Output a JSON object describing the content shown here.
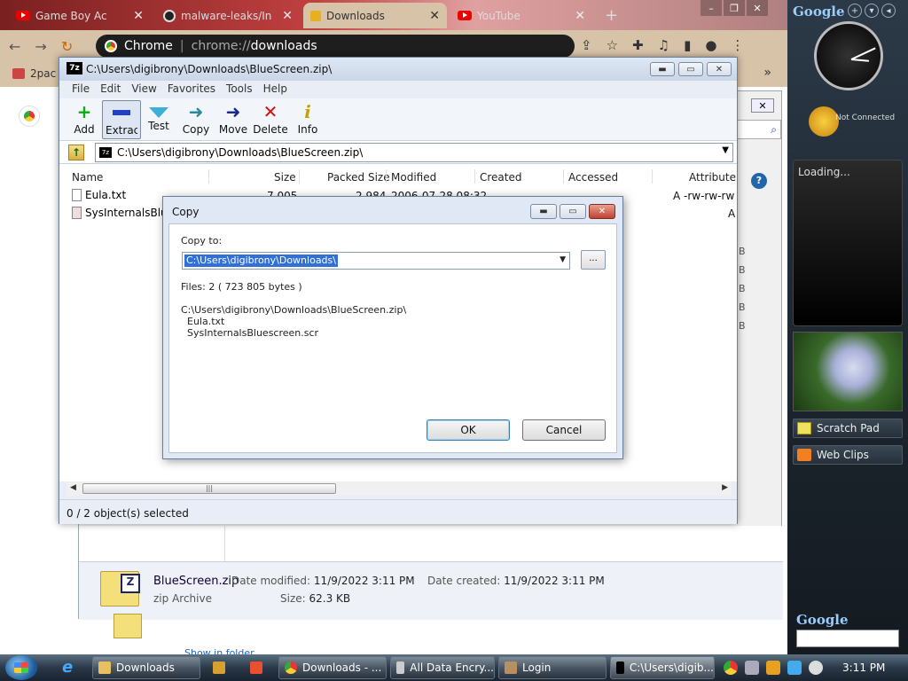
{
  "chrome": {
    "tabs": [
      {
        "label": "Game Boy Ac",
        "icon": "youtube-icon"
      },
      {
        "label": "malware-leaks/In",
        "icon": "github-icon"
      },
      {
        "label": "Downloads",
        "icon": "download-icon"
      },
      {
        "label": "YouTube",
        "icon": "youtube-icon"
      }
    ],
    "new_tab": "+",
    "omnibox_label": "Chrome",
    "omnibox_sep": "|",
    "omnibox_scheme": "chrome://",
    "omnibox_path": "downloads",
    "bookmark": "2pac",
    "bookmarks_more": "»"
  },
  "explorer": {
    "search_icon": "⌕",
    "help": "?",
    "side_letters": [
      "B",
      "B",
      "B",
      "B",
      "B"
    ],
    "file_name": "BlueScreen.zip",
    "file_type": "zip Archive",
    "modified_label": "Date modified:",
    "modified_value": "11/9/2022 3:11 PM",
    "created_label": "Date created:",
    "created_value": "11/9/2022 3:11 PM",
    "size_label": "Size:",
    "size_value": "62.3 KB",
    "under_text": "Show in folder"
  },
  "sevenzip": {
    "title": "C:\\Users\\digibrony\\Downloads\\BlueScreen.zip\\",
    "app_icon": "7z",
    "menu": [
      "File",
      "Edit",
      "View",
      "Favorites",
      "Tools",
      "Help"
    ],
    "toolbar": [
      {
        "label": "Add",
        "icon": "+"
      },
      {
        "label": "Extract",
        "icon": ""
      },
      {
        "label": "Test",
        "icon": ""
      },
      {
        "label": "Copy",
        "icon": "➜"
      },
      {
        "label": "Move",
        "icon": "➜"
      },
      {
        "label": "Delete",
        "icon": "✕"
      },
      {
        "label": "Info",
        "icon": "i"
      }
    ],
    "address": "C:\\Users\\digibrony\\Downloads\\BlueScreen.zip\\",
    "columns": [
      "Name",
      "Size",
      "Packed Size",
      "Modified",
      "Created",
      "Accessed",
      "Attribute"
    ],
    "rows": [
      {
        "name": "Eula.txt",
        "size": "7 005",
        "packed": "2 984",
        "modified": "2006-07-28 08:32",
        "attr": "A -rw-rw-rw"
      },
      {
        "name": "SysInternalsBluescreen.scr",
        "attr": "A"
      }
    ],
    "status": "0 / 2 object(s) selected",
    "scroll_grip": "|||"
  },
  "copy_dialog": {
    "title": "Copy",
    "copy_to_label": "Copy to:",
    "path_value": "C:\\Users\\digibrony\\Downloads\\",
    "browse_label": "...",
    "files_info": "Files: 2    ( 723 805 bytes )",
    "source_path": "C:\\Users\\digibrony\\Downloads\\BlueScreen.zip\\",
    "items": [
      "Eula.txt",
      "SysInternalsBluescreen.scr"
    ],
    "ok_label": "OK",
    "cancel_label": "Cancel"
  },
  "sidebar": {
    "google": "Google",
    "not_connected": "Not Connected",
    "loading": "Loading...",
    "scratch_pad": "Scratch Pad",
    "web_clips": "Web Clips",
    "google_bottom": "Google"
  },
  "taskbar": {
    "tasks": [
      "Downloads",
      "Downloads - ...",
      "All Data Encry...",
      "Login",
      "C:\\Users\\digib..."
    ],
    "time": "3:11 PM"
  }
}
